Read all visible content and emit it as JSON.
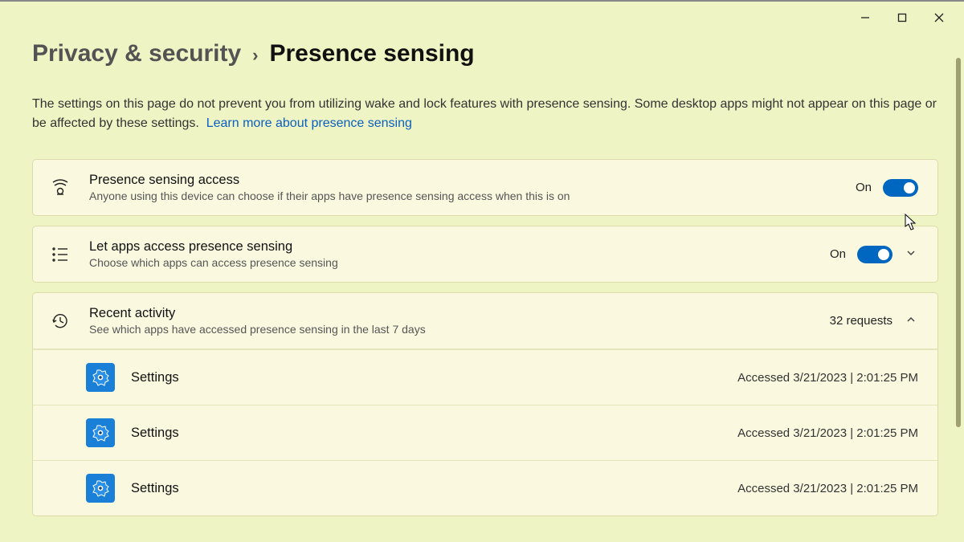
{
  "breadcrumb": {
    "parent": "Privacy & security",
    "current": "Presence sensing"
  },
  "description": {
    "text": "The settings on this page do not prevent you from utilizing wake and lock features with presence sensing. Some desktop apps might not appear on this page or be affected by these settings.",
    "link": "Learn more about presence sensing"
  },
  "panels": {
    "access": {
      "title": "Presence sensing access",
      "sub": "Anyone using this device can choose if their apps have presence sensing access when this is on",
      "state": "On"
    },
    "apps": {
      "title": "Let apps access presence sensing",
      "sub": "Choose which apps can access presence sensing",
      "state": "On"
    },
    "activity": {
      "title": "Recent activity",
      "sub": "See which apps have accessed presence sensing in the last 7 days",
      "count_label": "32 requests"
    }
  },
  "activity_rows": [
    {
      "app": "Settings",
      "time": "Accessed 3/21/2023  |  2:01:25 PM"
    },
    {
      "app": "Settings",
      "time": "Accessed 3/21/2023  |  2:01:25 PM"
    },
    {
      "app": "Settings",
      "time": "Accessed 3/21/2023  |  2:01:25 PM"
    }
  ]
}
